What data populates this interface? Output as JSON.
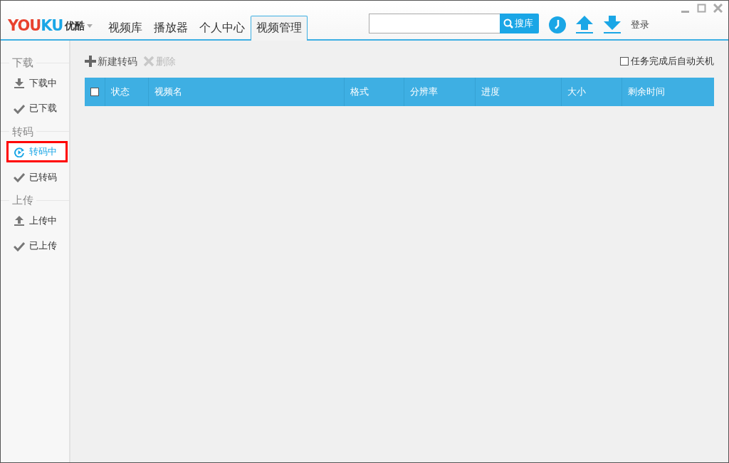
{
  "app": {
    "logo": "YOUKU",
    "logo_cn": "优酷"
  },
  "nav_tabs": [
    {
      "label": "视频库",
      "selected": false
    },
    {
      "label": "播放器",
      "selected": false
    },
    {
      "label": "个人中心",
      "selected": false
    },
    {
      "label": "视频管理",
      "selected": true
    }
  ],
  "search": {
    "button": "搜库"
  },
  "login": "登录",
  "sidebar": {
    "sections": [
      {
        "title": "下载",
        "items": [
          {
            "label": "下载中",
            "kind": "download",
            "selected": false
          },
          {
            "label": "已下载",
            "kind": "done",
            "selected": false
          }
        ]
      },
      {
        "title": "转码",
        "items": [
          {
            "label": "转码中",
            "kind": "converting",
            "selected": true
          },
          {
            "label": "已转码",
            "kind": "done",
            "selected": false
          }
        ]
      },
      {
        "title": "上传",
        "items": [
          {
            "label": "上传中",
            "kind": "upload",
            "selected": false
          },
          {
            "label": "已上传",
            "kind": "done",
            "selected": false
          }
        ]
      }
    ]
  },
  "toolbar": {
    "actions": [
      {
        "label": "新建转码",
        "kind": "add",
        "disabled": false
      },
      {
        "label": "删除",
        "kind": "delete",
        "disabled": true
      }
    ],
    "shutdown_option": {
      "label": "任务完成后自动关机",
      "checked": false
    }
  },
  "table": {
    "select_all_checked": false,
    "columns": [
      "状态",
      "视频名",
      "格式",
      "分辨率",
      "进度",
      "大小",
      "剩余时间"
    ]
  }
}
